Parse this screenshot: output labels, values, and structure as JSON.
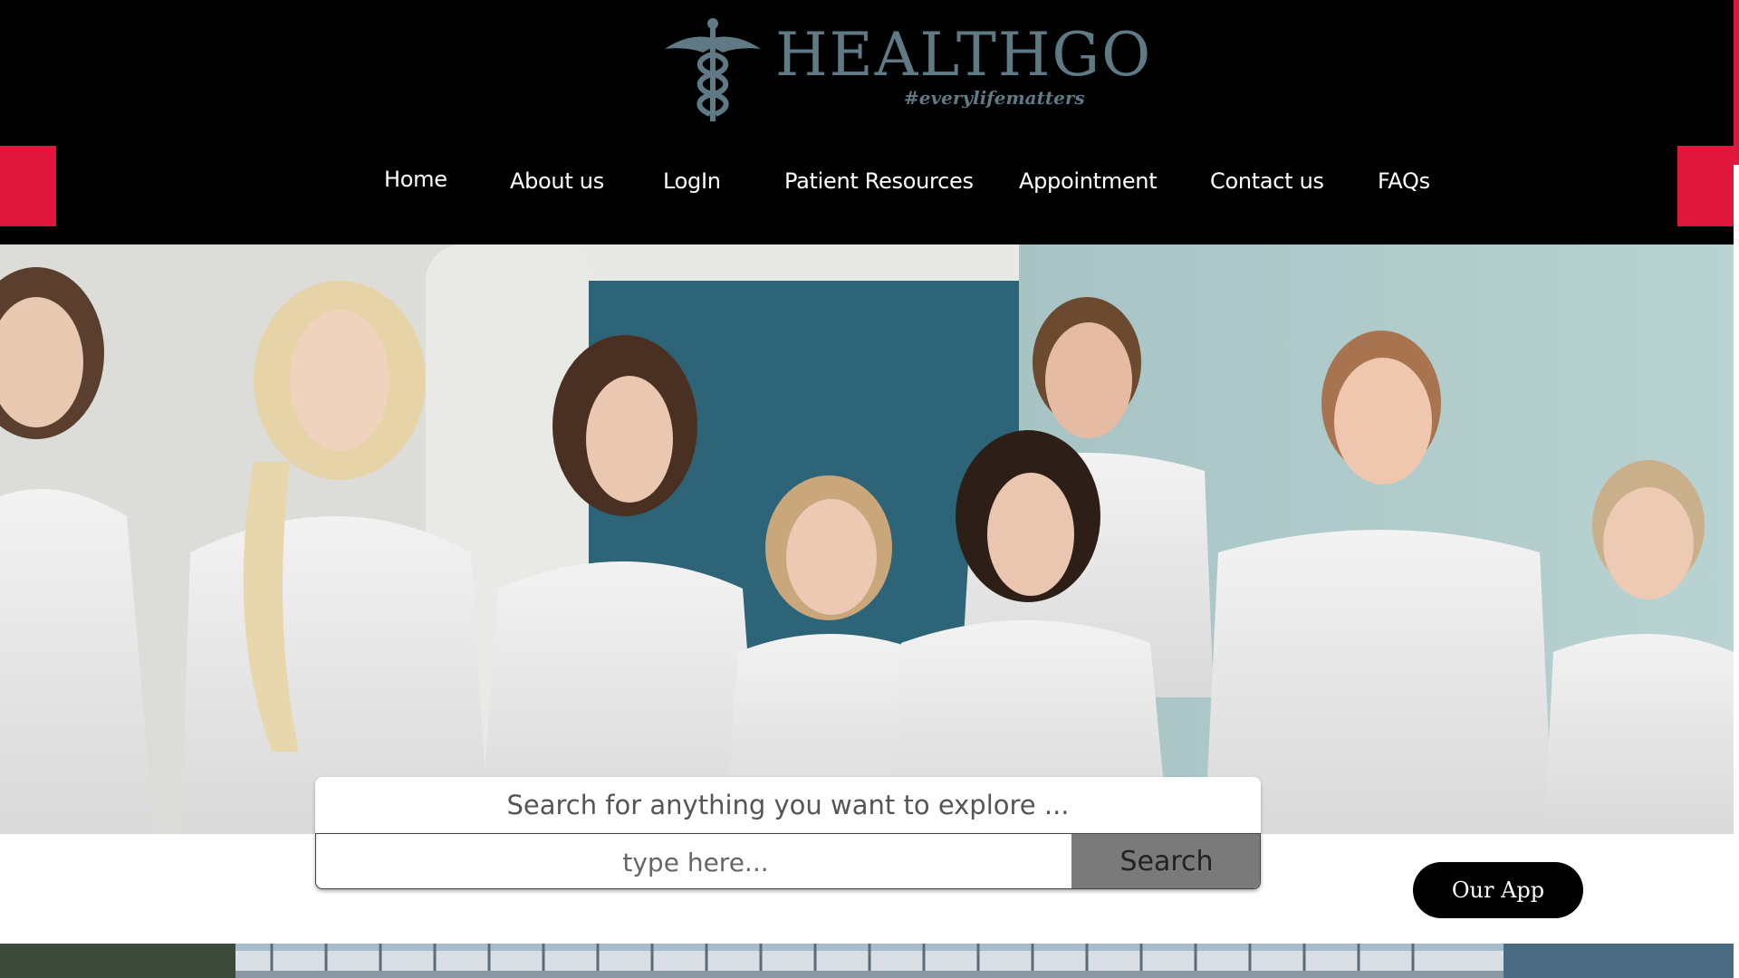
{
  "brand": {
    "name": "HEALTHGO",
    "tagline": "#everylifematters",
    "logo_icon": "caduceus-icon",
    "logo_color": "#5f7a84"
  },
  "nav": {
    "items": [
      {
        "label": "Home"
      },
      {
        "label": "About us"
      },
      {
        "label": "LogIn"
      },
      {
        "label": "Patient Resources"
      },
      {
        "label": "Appointment"
      },
      {
        "label": "Contact us"
      },
      {
        "label": "FAQs"
      }
    ]
  },
  "search": {
    "prompt": "Search for anything you want to explore ...",
    "placeholder": "type here...",
    "button_label": "Search"
  },
  "app_button": {
    "label": "Our App"
  },
  "colors": {
    "header_bg": "#000000",
    "accent": "#e0163c",
    "search_button": "#7a7a7a"
  }
}
